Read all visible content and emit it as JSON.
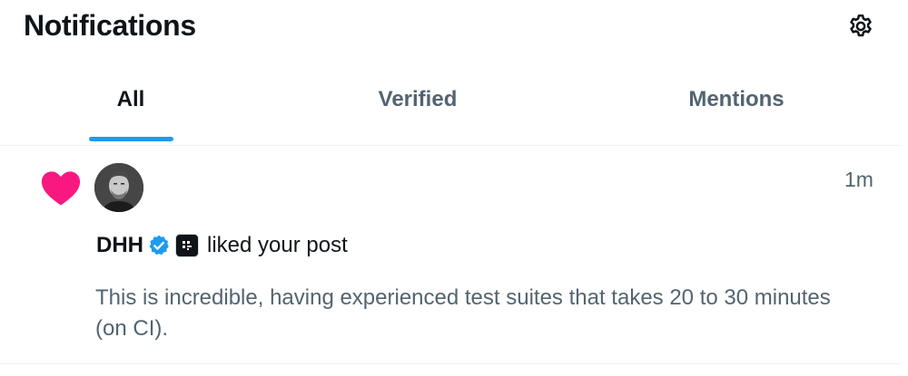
{
  "header": {
    "title": "Notifications",
    "settings_icon": "gear-icon"
  },
  "tabs": [
    {
      "label": "All",
      "active": true
    },
    {
      "label": "Verified",
      "active": false
    },
    {
      "label": "Mentions",
      "active": false
    }
  ],
  "colors": {
    "accent": "#1d9bf0",
    "like": "#f91880",
    "text_primary": "#0f1419",
    "text_secondary": "#536471"
  },
  "notification": {
    "type_icon": "heart-icon",
    "avatar": "user-avatar",
    "user_name": "DHH",
    "verified_icon": "verified-badge-icon",
    "affiliate_icon": "organization-badge-icon",
    "action": "liked your post",
    "time": "1m",
    "post_text": "This is incredible, having experienced test suites that takes 20 to 30 minutes (on CI)."
  }
}
